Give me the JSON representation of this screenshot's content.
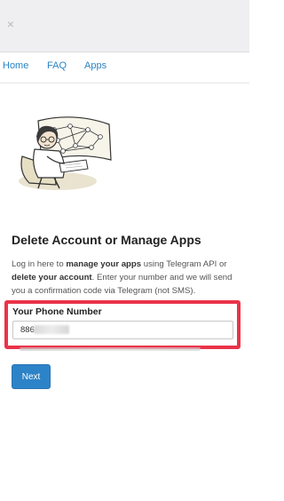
{
  "topbar": {
    "close_icon": "close-icon",
    "close_glyph": "×"
  },
  "nav": {
    "items": [
      {
        "label": "Home"
      },
      {
        "label": "FAQ"
      },
      {
        "label": "Apps"
      }
    ]
  },
  "colors": {
    "link": "#2a84c6",
    "button": "#2d83c7",
    "highlight": "#ea3349"
  },
  "hero": {
    "illustration": "woman-at-desk-with-network-diagram"
  },
  "page": {
    "heading": "Delete Account or Manage Apps",
    "desc_1": "Log in here to ",
    "desc_2": "manage your apps",
    "desc_3": " using Telegram API or ",
    "desc_4": "delete your account",
    "desc_5": ". Enter your number and we will send you a confirmation code via Telegram (not SMS)."
  },
  "form": {
    "phone_label": "Your Phone Number",
    "phone_value": "886",
    "next_label": "Next"
  }
}
